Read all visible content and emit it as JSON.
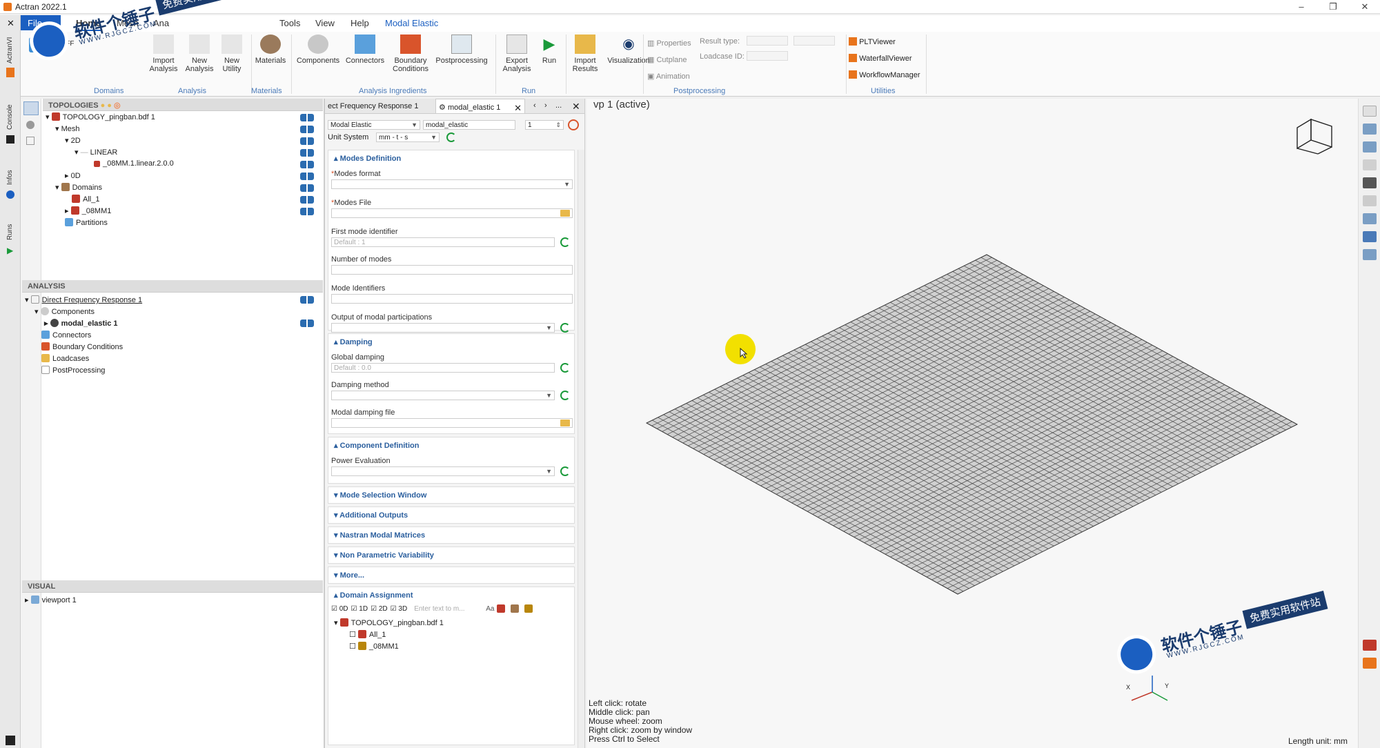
{
  "app": {
    "title": "Actran 2022.1"
  },
  "menu": {
    "file": "File",
    "items": [
      "Home",
      "Mesh",
      "Ana",
      "Tools",
      "View",
      "Help",
      "Modal Elastic"
    ]
  },
  "ribbon": {
    "nff": "NFF",
    "buttons": {
      "import_analysis": "Import\nAnalysis",
      "new_analysis": "New\nAnalysis",
      "new_utility": "New\nUtility",
      "materials": "Materials",
      "components": "Components",
      "connectors": "Connectors",
      "boundary": "Boundary\nConditions",
      "postprocessing": "Postprocessing",
      "export_analysis": "Export\nAnalysis",
      "run": "Run",
      "import_results": "Import\nResults",
      "visualization": "Visualization"
    },
    "small": {
      "properties": "Properties",
      "cutplane": "Cutplane",
      "animation": "Animation",
      "result_type": "Result type:",
      "loadcase_id": "Loadcase ID:"
    },
    "utilities": [
      "PLTViewer",
      "WaterfallViewer",
      "WorkflowManager"
    ],
    "groups": {
      "domains": "Domains",
      "analysis": "Analysis",
      "materials": "Materials",
      "ingredients": "Analysis Ingredients",
      "run": "Run",
      "postprocessing": "Postprocessing",
      "utilities": "Utilities"
    }
  },
  "sidebar_tabs": [
    "ActranVI",
    "Console",
    "Infos",
    "Runs"
  ],
  "topologies": {
    "header": "TOPOLOGIES",
    "items": [
      "TOPOLOGY_pingban.bdf 1",
      "Mesh",
      "2D",
      "LINEAR",
      "_08MM.1.linear.2.0.0",
      "0D",
      "Domains",
      "All_1",
      "_08MM1",
      "Partitions"
    ]
  },
  "analysis": {
    "header": "ANALYSIS",
    "items": [
      "Direct Frequency Response 1",
      "Components",
      "modal_elastic 1",
      "Connectors",
      "Boundary Conditions",
      "Loadcases",
      "PostProcessing"
    ]
  },
  "visual": {
    "header": "VISUAL",
    "items": [
      "viewport 1"
    ]
  },
  "tabs": {
    "tab1": "ect Frequency Response 1",
    "tab2": "modal_elastic 1",
    "more": "..."
  },
  "form": {
    "type": "Modal Elastic",
    "name": "modal_elastic",
    "index": "1",
    "unit_label": "Unit System",
    "unit": "mm - t - s",
    "modes_def": "Modes Definition",
    "modes_format": "Modes format",
    "modes_file": "Modes File",
    "first_mode": "First mode identifier",
    "first_mode_ph": "Default : 1",
    "num_modes": "Number of modes",
    "mode_ids": "Mode Identifiers",
    "output_modal": "Output of modal participations",
    "damping": "Damping",
    "global_damping": "Global damping",
    "global_damping_ph": "Default : 0.0",
    "damping_method": "Damping method",
    "modal_damping_file": "Modal damping file",
    "comp_def": "Component Definition",
    "power_eval": "Power Evaluation",
    "mode_sel": "Mode Selection Window",
    "add_out": "Additional Outputs",
    "nastran": "Nastran Modal Matrices",
    "nonparam": "Non Parametric Variability",
    "more": "More...",
    "domain_assign": "Domain Assignment",
    "filters": [
      "0D",
      "1D",
      "2D",
      "3D"
    ],
    "filter_ph": "Enter text to m...",
    "aa": "Aa",
    "dtree": [
      "TOPOLOGY_pingban.bdf 1",
      "All_1",
      "_08MM1"
    ]
  },
  "viewport": {
    "title": "vp 1 (active)",
    "hints": [
      "Left click: rotate",
      "Middle click: pan",
      "Mouse wheel: zoom",
      "Right click: zoom by window",
      "Press Ctrl to Select"
    ],
    "length_unit": "Length unit: mm",
    "axis_x": "X",
    "axis_y": "Y"
  },
  "watermark": {
    "cn": "软件个锤子",
    "slogan": "免费实用软件站",
    "url": "WWW.RJGCZ.COM"
  },
  "colors": {
    "accent": "#1b5fc1",
    "section": "#2b5f9e",
    "mesh": "#555555",
    "cursor": "#f2e000"
  }
}
